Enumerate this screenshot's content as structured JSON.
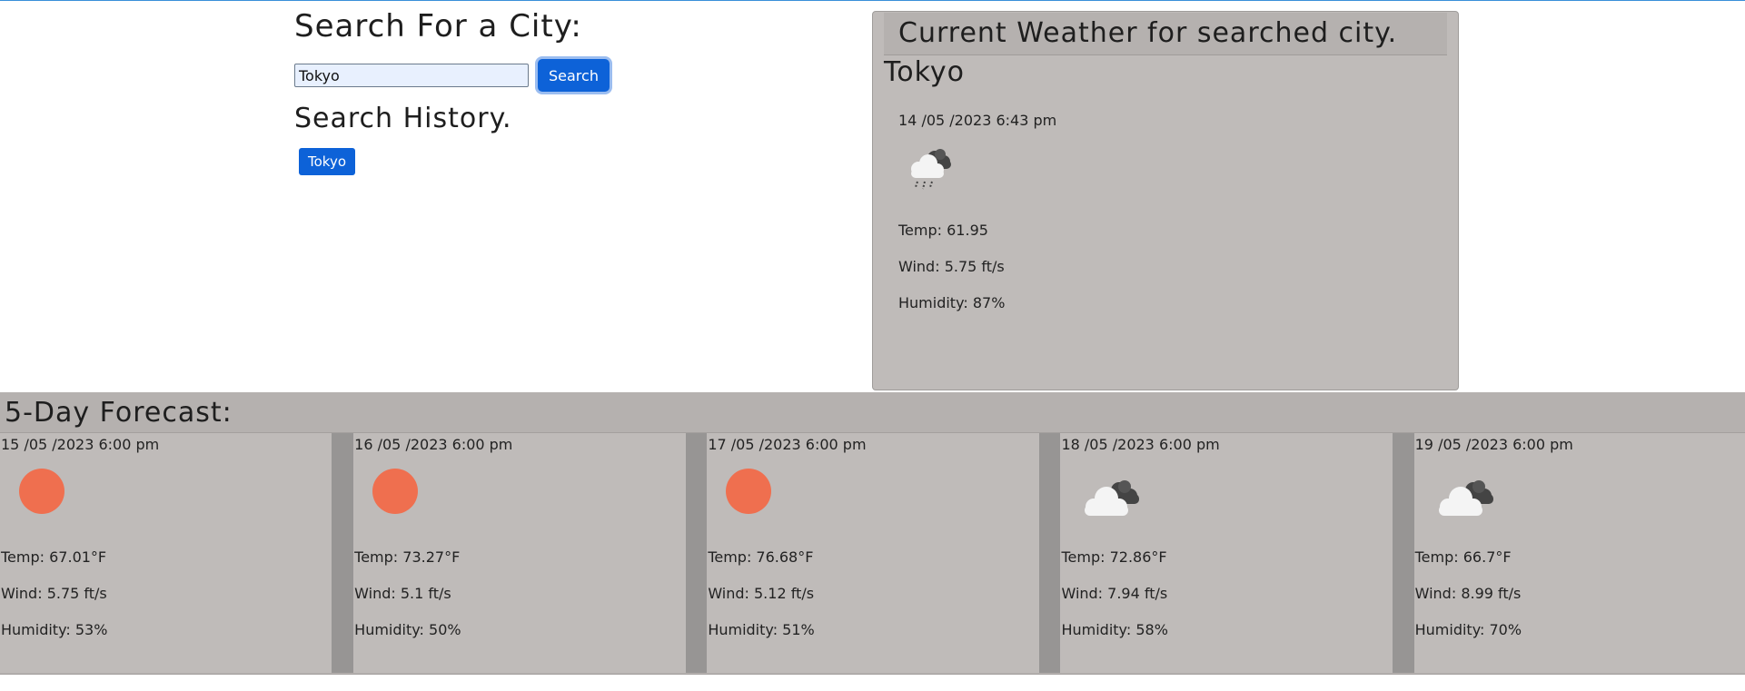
{
  "search": {
    "heading": "Search For a City:",
    "input_value": "Tokyo",
    "button_label": "Search",
    "history_heading": "Search History.",
    "history_items": [
      "Tokyo"
    ]
  },
  "current": {
    "heading": "Current Weather for searched city.",
    "city": "Tokyo",
    "date": "14 /05 /2023 6:43 pm",
    "icon": "rain-cloud-icon",
    "temp": "Temp: 61.95",
    "wind": "Wind: 5.75 ft/s",
    "humidity": "Humidity: 87%"
  },
  "forecast": {
    "heading": "5-Day Forecast:",
    "days": [
      {
        "date": "15 /05 /2023 6:00 pm",
        "icon": "sun-icon",
        "temp": "Temp: 67.01°F",
        "wind": "Wind: 5.75 ft/s",
        "humidity": "Humidity: 53%"
      },
      {
        "date": "16 /05 /2023 6:00 pm",
        "icon": "sun-icon",
        "temp": "Temp: 73.27°F",
        "wind": "Wind: 5.1 ft/s",
        "humidity": "Humidity: 50%"
      },
      {
        "date": "17 /05 /2023 6:00 pm",
        "icon": "sun-icon",
        "temp": "Temp: 76.68°F",
        "wind": "Wind: 5.12 ft/s",
        "humidity": "Humidity: 51%"
      },
      {
        "date": "18 /05 /2023 6:00 pm",
        "icon": "cloudy-icon",
        "temp": "Temp: 72.86°F",
        "wind": "Wind: 7.94 ft/s",
        "humidity": "Humidity: 58%"
      },
      {
        "date": "19 /05 /2023 6:00 pm",
        "icon": "cloudy-icon",
        "temp": "Temp: 66.7°F",
        "wind": "Wind: 8.99 ft/s",
        "humidity": "Humidity: 70%"
      }
    ]
  },
  "colors": {
    "primary_button": "#0d62d8",
    "card_bg": "#bfbbb9",
    "sun": "#ef6f4f"
  }
}
